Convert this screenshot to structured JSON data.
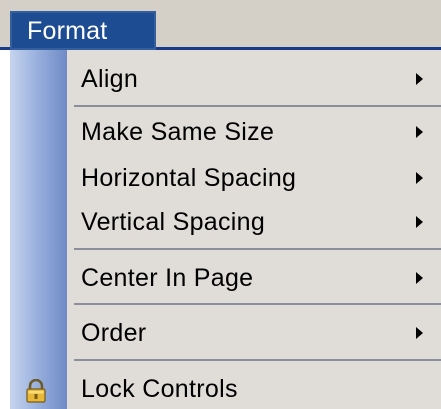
{
  "menubar": {
    "title": "Format"
  },
  "menu": {
    "items": [
      {
        "label": "Align",
        "submenu": true
      },
      {
        "label": "Make Same Size",
        "submenu": true
      },
      {
        "label": "Horizontal Spacing",
        "submenu": true
      },
      {
        "label": "Vertical Spacing",
        "submenu": true
      },
      {
        "label": "Center In Page",
        "submenu": true
      },
      {
        "label": "Order",
        "submenu": true
      },
      {
        "label": "Lock Controls",
        "submenu": false,
        "icon": "lock-icon"
      }
    ]
  },
  "colors": {
    "menu_title_bg": "#1e4c92",
    "gutter": "#7f97cf",
    "menu_bg": "#e0ddd8"
  }
}
